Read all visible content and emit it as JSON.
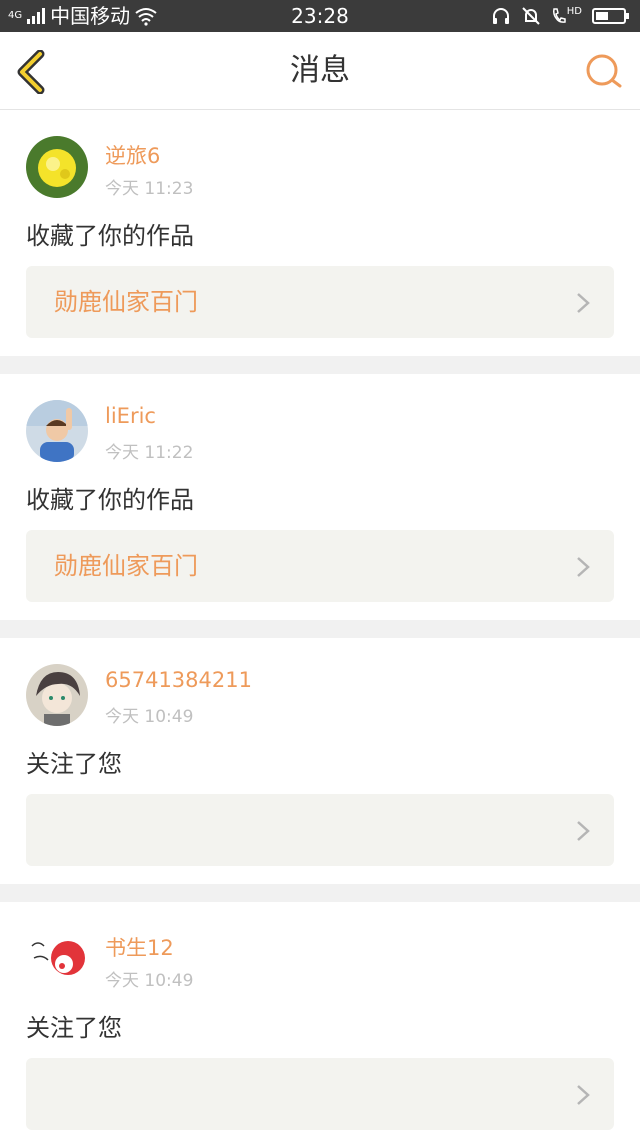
{
  "status_bar": {
    "network_type": "4G",
    "carrier": "中国移动",
    "time": "23:28",
    "hd_label": "HD"
  },
  "header": {
    "title": "消息",
    "accent_color": "#ee9a5a",
    "back_icon": "chevron-left-icon",
    "search_icon": "search-icon"
  },
  "messages": [
    {
      "username": "逆旅6",
      "time": "今天 11:23",
      "action": "收藏了你的作品",
      "work_title": "勋鹿仙家百门"
    },
    {
      "username": "liEric",
      "time": "今天 11:22",
      "action": "收藏了你的作品",
      "work_title": "勋鹿仙家百门"
    },
    {
      "username": "65741384211",
      "time": "今天 10:49",
      "action": "关注了您",
      "work_title": ""
    },
    {
      "username": "书生12",
      "time": "今天 10:49",
      "action": "关注了您",
      "work_title": ""
    }
  ]
}
